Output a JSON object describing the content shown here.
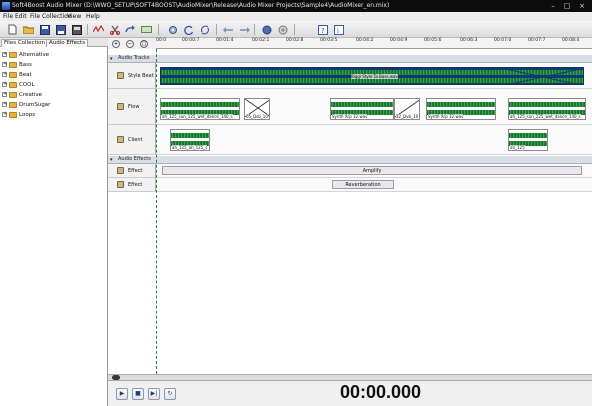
{
  "window": {
    "title": "Soft4Boost Audio Mixer (D:\\WWO_SETUP\\SOFT4BOOST\\AudioMixer\\Release\\Audio Mixer Projects\\Sample4\\AudioMixer_en.mix)",
    "minimize_glyph": "–",
    "maximize_glyph": "□",
    "close_glyph": "×"
  },
  "menu": [
    "File",
    "Edit",
    "File Collection",
    "View",
    "Help"
  ],
  "toolbar": {
    "icons": [
      "new-project-icon",
      "open-project-icon",
      "save-project-icon",
      "save-as-icon",
      "export-icon",
      "cut-icon",
      "delete-icon",
      "undo-icon",
      "redo-icon",
      "edit-icon",
      "settings-icon",
      "refresh-icon",
      "help-icon",
      "info-icon"
    ]
  },
  "left_panel": {
    "tabs": [
      "Files Collection",
      "Audio Effects"
    ],
    "items": [
      "Alternative",
      "Bass",
      "Beat",
      "COOL",
      "Creative",
      "DrumSugar",
      "Loops"
    ]
  },
  "timeline": {
    "ticks": [
      "00:0",
      "00:00:7",
      "00:01:4",
      "00:02:1",
      "00:02:8",
      "00:03:5",
      "00:04:2",
      "00:04:9",
      "00:05:6",
      "00:06:3",
      "00:07:0",
      "00:07:7",
      "00:08:4",
      "00:09:1"
    ],
    "zoom_icons": [
      "zoom-in-icon",
      "zoom-out-icon",
      "zoom-fit-icon"
    ]
  },
  "audio_tracks": {
    "label": "Audio Tracks",
    "tracks": [
      {
        "name": "Style Beat",
        "clips": [
          {
            "label": "Biggi Style Ta Bass.wav"
          }
        ]
      },
      {
        "name": "Flow",
        "clips": [
          {
            "label": "ah_125_sun_125_wet_dance_140_s"
          },
          {
            "label": "05_Dsb_10"
          },
          {
            "label": "Synth Arp 32.wav"
          },
          {
            "label": "32_Dvb_10"
          },
          {
            "label": "Synth Arp 32.wav"
          },
          {
            "label": "ah_125_sun_125_wet_dance_140_s"
          }
        ]
      },
      {
        "name": "Client",
        "clips": [
          {
            "label": "ah_125_ah_125_s"
          },
          {
            "label": "ah_125"
          }
        ]
      }
    ]
  },
  "audio_effects": {
    "label": "Audio Effects",
    "tracks": [
      {
        "name": "Effect",
        "effect": "Amplify"
      },
      {
        "name": "Effect",
        "effect": "Reverberation"
      }
    ]
  },
  "transport": {
    "buttons": [
      "play",
      "stop",
      "next",
      "loop"
    ],
    "time": "00:00.000"
  },
  "colors": {
    "waveform": "#1f7d33",
    "selection": "#0a3a7a"
  }
}
